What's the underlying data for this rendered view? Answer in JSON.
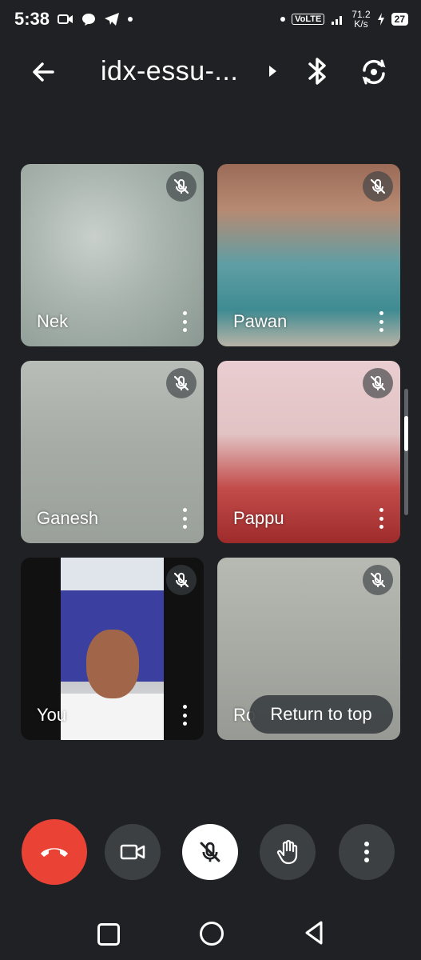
{
  "status_bar": {
    "time": "5:38",
    "network_type": "VoLTE",
    "speed_value": "71.2",
    "speed_unit": "K/s",
    "battery": "27"
  },
  "header": {
    "meeting_title": "idx-essu-..."
  },
  "participants": [
    {
      "name": "Nek",
      "muted": true
    },
    {
      "name": "Pawan",
      "muted": true
    },
    {
      "name": "Ganesh",
      "muted": true
    },
    {
      "name": "Pappu",
      "muted": true
    },
    {
      "name": "You",
      "muted": true
    },
    {
      "name": "Ro",
      "muted": true
    }
  ],
  "return_to_top": "Return to top",
  "colors": {
    "background": "#202124",
    "end_call": "#ea4335",
    "control": "#3c4043"
  },
  "icons": {
    "back": "arrow-left-icon",
    "bluetooth": "bluetooth-icon",
    "switch_camera": "switch-camera-icon",
    "mic_off": "mic-off-icon",
    "end_call": "phone-hangup-icon",
    "camera": "videocam-icon",
    "raise_hand": "hand-icon",
    "more": "more-vert-icon"
  }
}
